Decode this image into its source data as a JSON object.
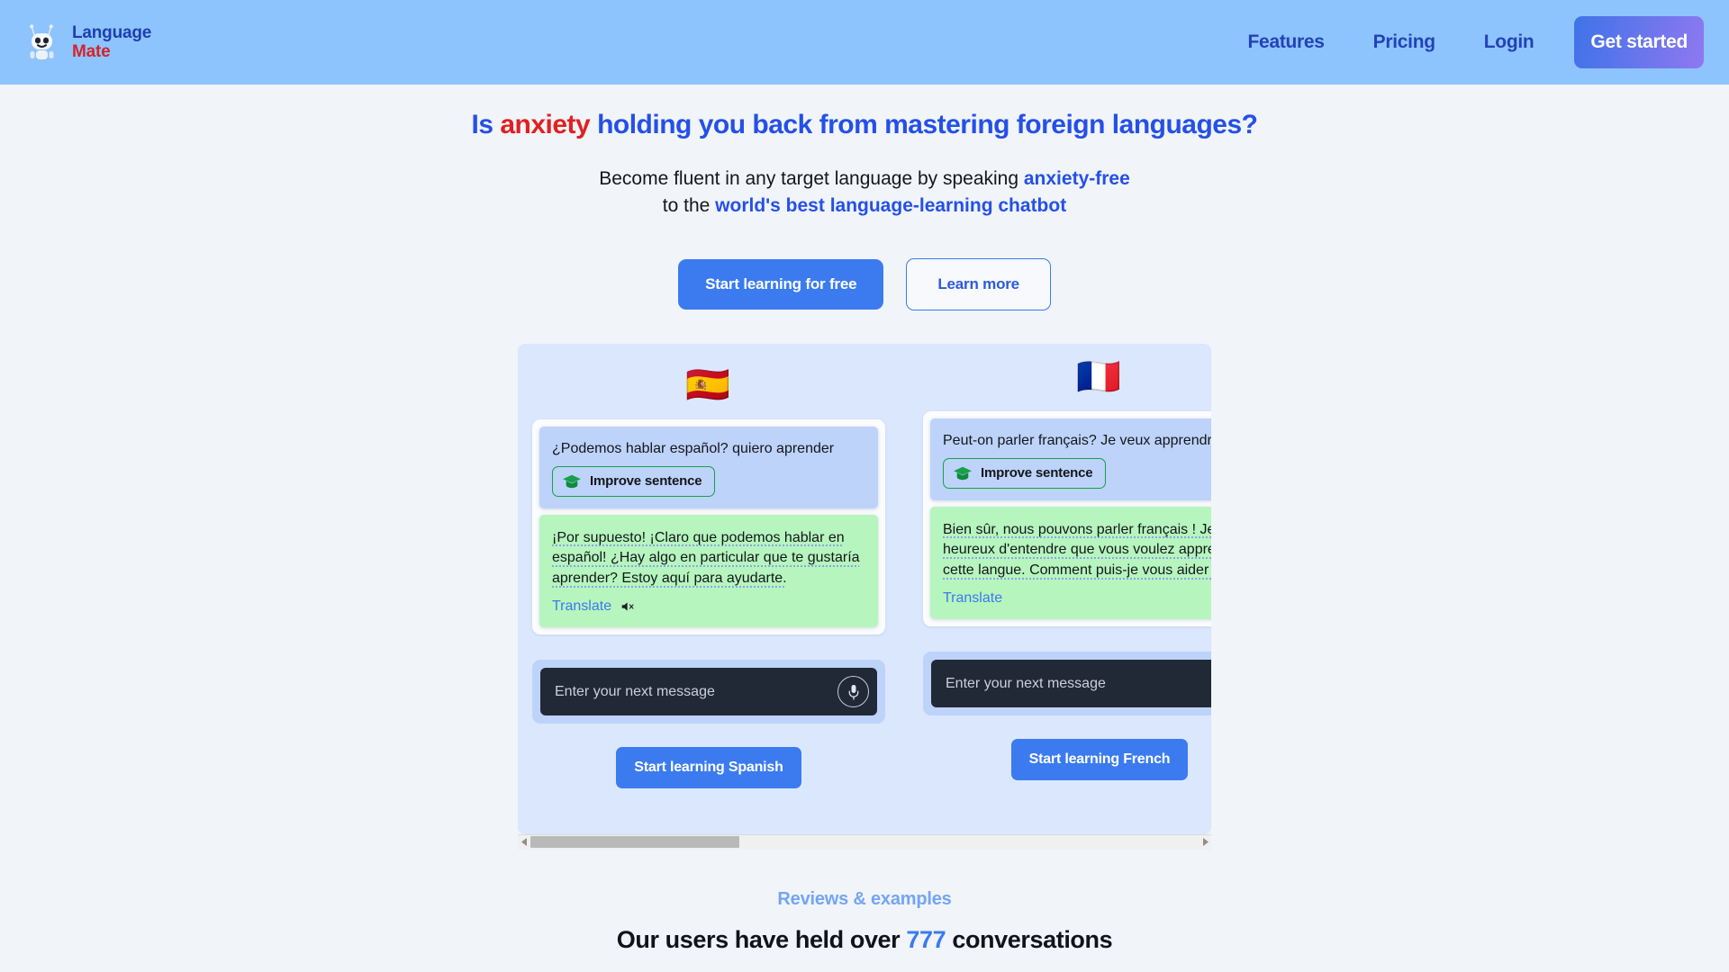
{
  "header": {
    "logo_icon": "robot-icon",
    "brand_line1": "Language",
    "brand_line2": "Mate",
    "nav": [
      {
        "label": "Features",
        "name": "nav-link-features"
      },
      {
        "label": "Pricing",
        "name": "nav-link-pricing"
      },
      {
        "label": "Login",
        "name": "nav-link-login"
      }
    ],
    "cta_label": "Get started"
  },
  "hero": {
    "headline_part1": "Is ",
    "headline_highlight": "anxiety",
    "headline_part2": " holding you back from mastering foreign languages?",
    "sub_line1_plain": "Become fluent in any target language by speaking ",
    "sub_line1_strong": "anxiety-free",
    "sub_line2_plain": "to the ",
    "sub_line2_strong": "world's best language-learning chatbot",
    "primary_cta": "Start learning for free",
    "secondary_cta": "Learn more"
  },
  "demo": {
    "cards": [
      {
        "flag": "🇪🇸",
        "user_message": "¿Podemos hablar español? quiero aprender",
        "improve_label": "Improve sentence",
        "improve_icon": "graduation-cap-icon",
        "bot_message": "¡Por supuesto! ¡Claro que podemos hablar en español! ¿Hay algo en particular que te gustaría aprender? Estoy aquí para ayudarte.",
        "translate_label": "Translate",
        "has_mute_icon": true,
        "input_placeholder": "Enter your next message",
        "input_value": "",
        "mic_icon": "microphone-icon",
        "start_label": "Start learning Spanish"
      },
      {
        "flag": "🇫🇷",
        "user_message": "Peut-on parler français? Je veux apprendre",
        "improve_label": "Improve sentence",
        "improve_icon": "graduation-cap-icon",
        "bot_message": "Bien sûr, nous pouvons parler français ! Je suis heureux d'entendre que vous voulez apprendre cette langue. Comment puis-je vous aider ?",
        "translate_label": "Translate",
        "has_mute_icon": false,
        "input_placeholder": "Enter your next message",
        "input_value": "",
        "mic_icon": "microphone-icon",
        "start_label": "Start learning French"
      }
    ]
  },
  "reviews": {
    "eyebrow": "Reviews & examples",
    "title_part1": "Our users have held over ",
    "title_number": "777",
    "title_part2": " conversations"
  },
  "colors": {
    "header_bg": "#8EC4FD",
    "page_bg": "#F1F4F9",
    "brand_blue": "#1E3FAF",
    "brand_red": "#D3242B",
    "headline_blue": "#2450E8",
    "headline_red": "#E02020",
    "primary_button": "#3B7BEF",
    "demo_bg": "#DBE7FD",
    "user_bubble": "#BDD3FA",
    "bot_bubble": "#B6F5BE",
    "improve_border": "#18A145",
    "input_bg": "#222936",
    "link_blue": "#3E79EE",
    "eyebrow_blue": "#74A5F5"
  }
}
